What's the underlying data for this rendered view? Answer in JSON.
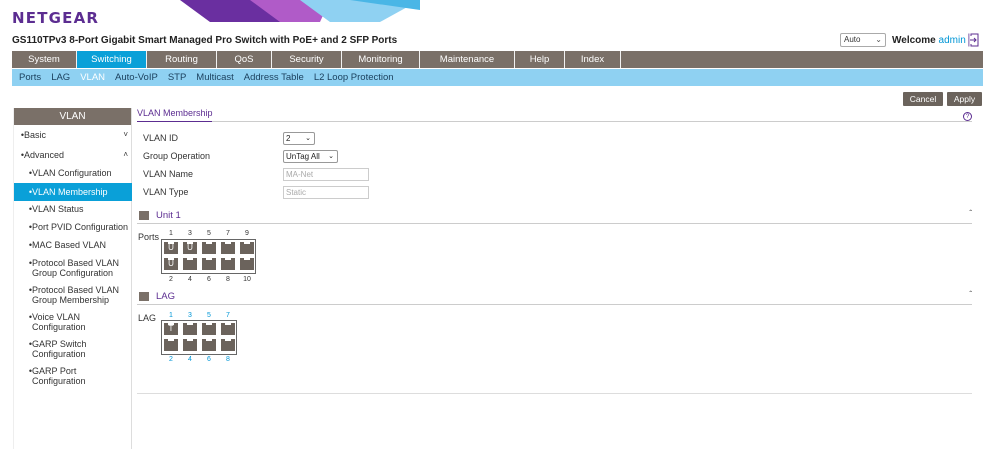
{
  "header": {
    "logo": "NETGEAR",
    "product_title": "GS110TPv3 8-Port Gigabit Smart Managed Pro Switch with PoE+ and 2 SFP Ports",
    "language_selected": "Auto",
    "welcome": "Welcome",
    "user": "admin"
  },
  "nav_main": [
    "System",
    "Switching",
    "Routing",
    "QoS",
    "Security",
    "Monitoring",
    "Maintenance",
    "Help",
    "Index"
  ],
  "nav_main_active": "Switching",
  "nav_sub": [
    "Ports",
    "LAG",
    "VLAN",
    "Auto-VoIP",
    "STP",
    "Multicast",
    "Address Table",
    "L2 Loop Protection"
  ],
  "nav_sub_active": "VLAN",
  "buttons": {
    "cancel": "Cancel",
    "apply": "Apply"
  },
  "sidebar": {
    "title": "VLAN",
    "items": [
      {
        "label": "Basic",
        "level": 0,
        "expand": "˅"
      },
      {
        "label": "Advanced",
        "level": 0,
        "expand": "˄"
      },
      {
        "label": "VLAN Configuration",
        "level": 1
      },
      {
        "label": "VLAN Membership",
        "level": 1,
        "active": true
      },
      {
        "label": "VLAN Status",
        "level": 1
      },
      {
        "label": "Port PVID Configuration",
        "level": 1
      },
      {
        "label": "MAC Based VLAN",
        "level": 1
      },
      {
        "label": "Protocol Based VLAN Group Configuration",
        "level": 1
      },
      {
        "label": "Protocol Based VLAN Group Membership",
        "level": 1
      },
      {
        "label": "Voice VLAN Configuration",
        "level": 1
      },
      {
        "label": "GARP Switch Configuration",
        "level": 1
      },
      {
        "label": "GARP Port Configuration",
        "level": 1
      }
    ]
  },
  "content": {
    "section_title": "VLAN Membership",
    "help": "?",
    "form": {
      "vlan_id_label": "VLAN ID",
      "vlan_id_value": "2",
      "group_operation_label": "Group Operation",
      "group_operation_value": "UnTag All",
      "vlan_name_label": "VLAN Name",
      "vlan_name_value": "MA-Net",
      "vlan_type_label": "VLAN Type",
      "vlan_type_value": "Static"
    },
    "unit": {
      "title": "Unit 1",
      "row_label": "Ports",
      "top_numbers": [
        "1",
        "3",
        "5",
        "7",
        "9"
      ],
      "bottom_numbers": [
        "2",
        "4",
        "6",
        "8",
        "10"
      ],
      "top_ports": [
        "U",
        "U",
        "",
        "",
        ""
      ],
      "bottom_ports": [
        "U",
        "",
        "",
        "",
        ""
      ]
    },
    "lag": {
      "title": "LAG",
      "row_label": "LAG",
      "top_numbers": [
        "1",
        "3",
        "5",
        "7"
      ],
      "bottom_numbers": [
        "2",
        "4",
        "6",
        "8"
      ],
      "top_ports": [
        "T",
        "",
        "",
        ""
      ],
      "bottom_ports": [
        "",
        "",
        "",
        ""
      ]
    }
  },
  "colors": {
    "brand_purple": "#5c2d91",
    "nav_grey": "#7a7068",
    "accent_blue": "#0aa0d8",
    "subnav_blue": "#8fd1f2"
  }
}
